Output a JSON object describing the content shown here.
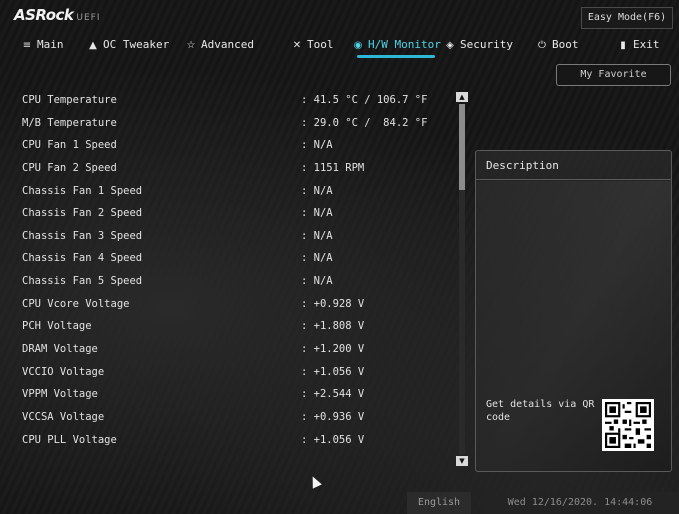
{
  "brand": {
    "name": "ASRock",
    "sub": "UEFI"
  },
  "easy_mode_label": "Easy Mode(F6)",
  "tabs": [
    {
      "label": "Main",
      "icon": "list-icon"
    },
    {
      "label": "OC Tweaker",
      "icon": "rocket-icon"
    },
    {
      "label": "Advanced",
      "icon": "star-icon"
    },
    {
      "label": "Tool",
      "icon": "wrench-icon"
    },
    {
      "label": "H/W Monitor",
      "icon": "monitor-icon"
    },
    {
      "label": "Security",
      "icon": "shield-icon"
    },
    {
      "label": "Boot",
      "icon": "power-icon"
    },
    {
      "label": "Exit",
      "icon": "exit-icon"
    }
  ],
  "active_tab": "H/W Monitor",
  "my_favorite_label": "My Favorite",
  "rows": [
    {
      "label": "CPU Temperature",
      "value": ": 41.5 °C / 106.7 °F"
    },
    {
      "label": "M/B Temperature",
      "value": ": 29.0 °C /  84.2 °F"
    },
    {
      "label": "CPU Fan 1 Speed",
      "value": ": N/A"
    },
    {
      "label": "CPU Fan 2 Speed",
      "value": ": 1151 RPM"
    },
    {
      "label": "Chassis Fan 1 Speed",
      "value": ": N/A"
    },
    {
      "label": "Chassis Fan 2 Speed",
      "value": ": N/A"
    },
    {
      "label": "Chassis Fan 3 Speed",
      "value": ": N/A"
    },
    {
      "label": "Chassis Fan 4 Speed",
      "value": ": N/A"
    },
    {
      "label": "Chassis Fan 5 Speed",
      "value": ": N/A"
    },
    {
      "label": "CPU Vcore Voltage",
      "value": ": +0.928 V"
    },
    {
      "label": "PCH Voltage",
      "value": ": +1.808 V"
    },
    {
      "label": "DRAM Voltage",
      "value": ": +1.200 V"
    },
    {
      "label": "VCCIO Voltage",
      "value": ": +1.056 V"
    },
    {
      "label": "VPPM Voltage",
      "value": ": +2.544 V"
    },
    {
      "label": "VCCSA Voltage",
      "value": ": +0.936 V"
    },
    {
      "label": "CPU PLL Voltage",
      "value": ": +1.056 V"
    }
  ],
  "description": {
    "title": "Description",
    "qr_text": "Get details via QR code"
  },
  "footer": {
    "language": "English",
    "datetime": "Wed 12/16/2020. 14:44:06"
  },
  "colors": {
    "accent": "#2fb8d6",
    "active_tab_text": "#4fd3e8",
    "background": "#141414"
  }
}
